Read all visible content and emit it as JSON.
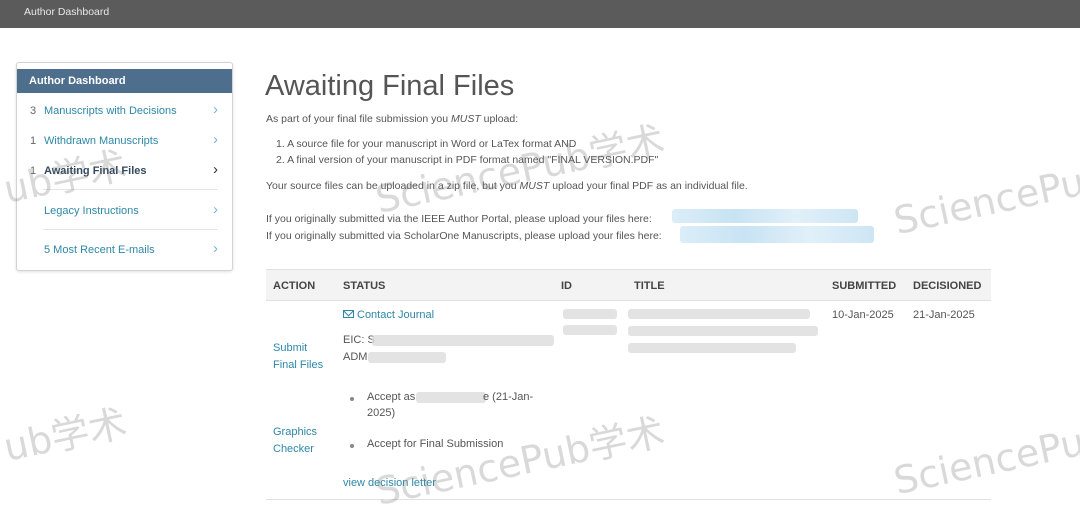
{
  "topbar": {
    "title": "Author Dashboard"
  },
  "sidebar": {
    "header": "Author Dashboard",
    "items": [
      {
        "count": "3",
        "label": "Manuscripts with Decisions"
      },
      {
        "count": "1",
        "label": "Withdrawn Manuscripts"
      },
      {
        "count": "1",
        "label": "Awaiting Final Files"
      },
      {
        "count": "",
        "label": "Legacy Instructions"
      },
      {
        "count": "",
        "label": "5 Most Recent E-mails"
      }
    ]
  },
  "main": {
    "title": "Awaiting Final Files",
    "intro_prefix": "As part of your final file submission you ",
    "intro_em": "MUST",
    "intro_suffix": " upload:",
    "list": [
      "1.  A source file for your manuscript in Word or LaTex format AND",
      "2.  A final version of your manuscript in PDF format named \"FINAL VERSION.PDF\""
    ],
    "source_prefix": "Your source files can be uploaded in a zip file, but you ",
    "source_em": "MUST",
    "source_suffix": " upload your final PDF as an individual file.",
    "ieee_line": "If you originally submitted via the IEEE Author Portal, please upload your files here:",
    "s1_line": "If you originally submitted via ScholarOne Manuscripts, please upload your files here:"
  },
  "table": {
    "headers": {
      "action": "ACTION",
      "status": "STATUS",
      "id": "ID",
      "title": "TITLE",
      "submitted": "SUBMITTED",
      "decisioned": "DECISIONED"
    },
    "row": {
      "submit_final_files": [
        "Submit",
        "Final Files"
      ],
      "graphics_checker": [
        "Graphics",
        "Checker"
      ],
      "contact_journal": "Contact Journal",
      "eic_label": "EIC: S",
      "adm_label": "ADM",
      "accept_as_prefix": "Accept as",
      "accept_as_suffix": "e (21-Jan-",
      "accept_as_year": "2025)",
      "accept_final": "Accept for Final Submission",
      "view_decision": "view decision letter",
      "submitted": "10-Jan-2025",
      "decisioned": "21-Jan-2025"
    }
  },
  "watermarks": [
    "ub学术",
    "SciencePub学术",
    "SciencePu",
    "ub学术",
    "SciencePub学术",
    "SciencePu"
  ]
}
